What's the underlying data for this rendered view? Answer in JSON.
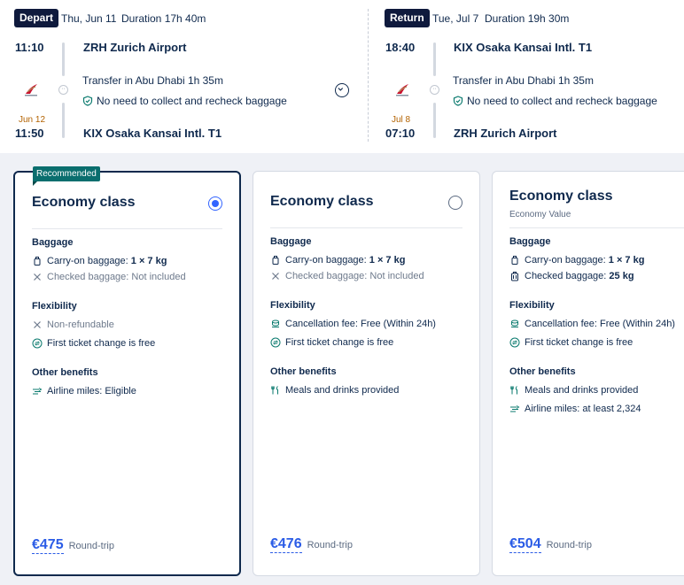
{
  "depart": {
    "chip": "Depart",
    "date": "Thu, Jun 11",
    "duration": "Duration 17h 40m",
    "dep_time": "11:10",
    "dep_airport": "ZRH Zurich Airport",
    "transfer": "Transfer in Abu Dhabi  1h 35m",
    "baggage_note": "No need to collect and recheck baggage",
    "arr_nextday": "Jun 12",
    "arr_time": "11:50",
    "arr_airport": "KIX Osaka Kansai Intl. T1"
  },
  "return": {
    "chip": "Return",
    "date": "Tue, Jul 7",
    "duration": "Duration 19h 30m",
    "dep_time": "18:40",
    "dep_airport": "KIX Osaka Kansai Intl. T1",
    "transfer": "Transfer in Abu Dhabi  1h 35m",
    "baggage_note": "No need to collect and recheck baggage",
    "arr_nextday": "Jul 8",
    "arr_time": "07:10",
    "arr_airport": "ZRH Zurich Airport"
  },
  "cards": [
    {
      "tag": "Recommended",
      "title": "Economy class",
      "baggage_head": "Baggage",
      "carry_label": "Carry-on baggage: ",
      "carry_value": "1 × 7 kg",
      "checked_label": "Checked baggage: Not included",
      "flex_head": "Flexibility",
      "flex1": "Non-refundable",
      "flex2": "First ticket change is free",
      "other_head": "Other benefits",
      "other1": "Airline miles: Eligible",
      "price": "€475",
      "price_note": "Round-trip"
    },
    {
      "title": "Economy class",
      "baggage_head": "Baggage",
      "carry_label": "Carry-on baggage: ",
      "carry_value": "1 × 7 kg",
      "checked_label": "Checked baggage: Not included",
      "flex_head": "Flexibility",
      "flex1": "Cancellation fee: Free (Within 24h)",
      "flex2": "First ticket change is free",
      "other_head": "Other benefits",
      "other1": "Meals and drinks provided",
      "price": "€476",
      "price_note": "Round-trip"
    },
    {
      "title": "Economy class",
      "subtitle": "Economy Value",
      "baggage_head": "Baggage",
      "carry_label": "Carry-on baggage: ",
      "carry_value": "1 × 7 kg",
      "checked_label": "Checked baggage: ",
      "checked_value": "25 kg",
      "flex_head": "Flexibility",
      "flex1": "Cancellation fee: Free (Within 24h)",
      "flex2": "First ticket change is free",
      "other_head": "Other benefits",
      "other1": "Meals and drinks provided",
      "other2": "Airline miles: at least 2,324",
      "price": "€504",
      "price_note": "Round-trip"
    }
  ]
}
